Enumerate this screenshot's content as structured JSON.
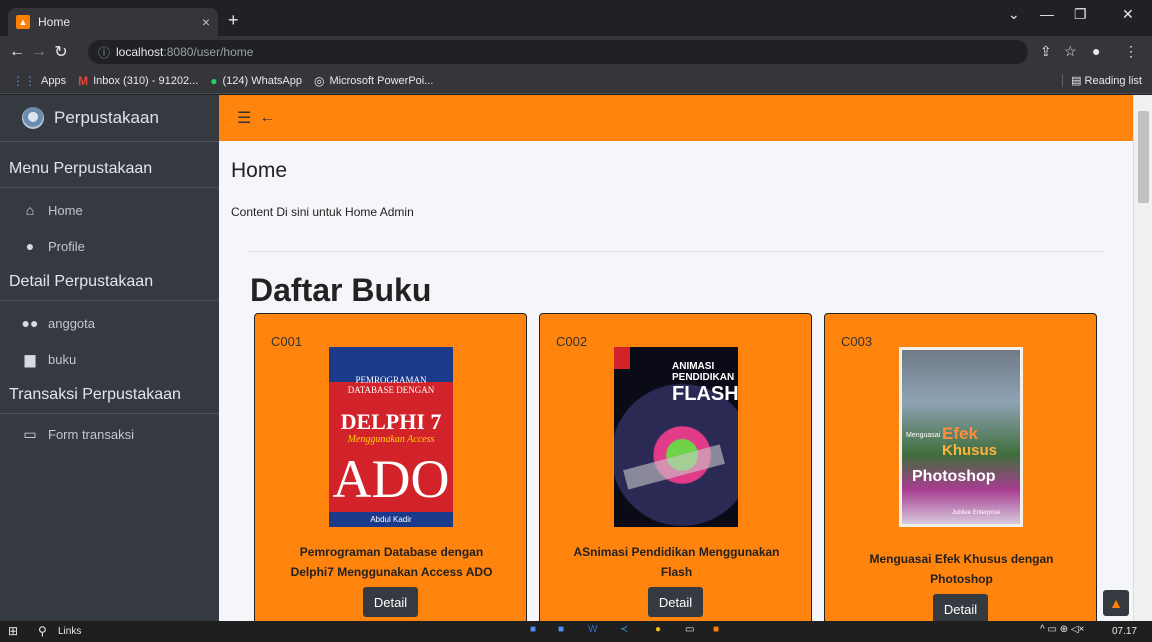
{
  "browser": {
    "tab_title": "Home",
    "tab_close": "×",
    "new_tab": "+",
    "url_host": "localhost",
    "url_rest": ":8080/user/home",
    "bookmarks": [
      {
        "icon": "apps-icon",
        "label": "Apps"
      },
      {
        "icon": "gmail-icon",
        "label": "Inbox (310) - 91202..."
      },
      {
        "icon": "whatsapp-icon",
        "label": "(124) WhatsApp"
      },
      {
        "icon": "powerpoint-icon",
        "label": "Microsoft PowerPoi..."
      }
    ],
    "reading_list": "Reading list"
  },
  "sidebar": {
    "brand": "Perpustakaan",
    "sections": [
      {
        "header": "Menu Perpustakaan",
        "items": [
          {
            "icon": "home-icon",
            "label": "Home"
          },
          {
            "icon": "user-icon",
            "label": "Profile"
          }
        ]
      },
      {
        "header": "Detail Perpustakaan",
        "items": [
          {
            "icon": "users-icon",
            "label": "anggota"
          },
          {
            "icon": "book-icon",
            "label": "buku"
          }
        ]
      },
      {
        "header": "Transaksi Perpustakaan",
        "items": [
          {
            "icon": "laptop-icon",
            "label": "Form transaksi"
          }
        ]
      }
    ]
  },
  "main": {
    "page_title": "Home",
    "subtitle": "Content Di sini untuk Home Admin",
    "section_title": "Daftar Buku",
    "detail_label": "Detail",
    "books": [
      {
        "code": "C001",
        "title_line1": "Pemrograman Database dengan",
        "title_line2": "Delphi7 Menggunakan Access ADO",
        "cover_lines": [
          "PEMROGRAMAN",
          "DATABASE DENGAN",
          "DELPHI 7",
          "Menggunakan Access",
          "ADO",
          "Abdul Kadir"
        ]
      },
      {
        "code": "C002",
        "title_line1": "ASnimasi Pendidikan Menggunakan",
        "title_line2": "Flash",
        "cover_lines": [
          "ANIMASI",
          "PENDIDIKAN",
          "FLASH"
        ]
      },
      {
        "code": "C003",
        "title_line1": "Menguasai Efek Khusus dengan",
        "title_line2": "Photoshop",
        "cover_lines": [
          "Menguasai",
          "Efek",
          "Khusus",
          "Photoshop",
          "Jubilee Enterprise"
        ]
      }
    ]
  },
  "taskbar": {
    "search_label": "Links",
    "time": "07.17"
  },
  "colors": {
    "accent": "#ff840e",
    "sidebar": "#343a40"
  }
}
